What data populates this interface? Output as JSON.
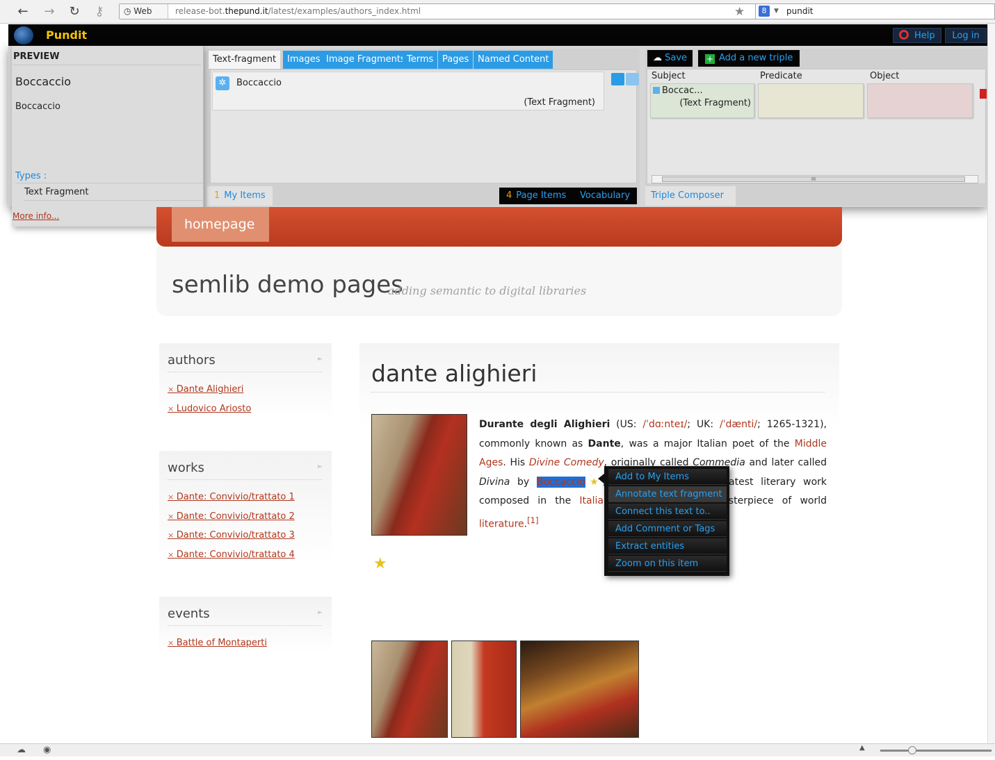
{
  "browser": {
    "back_icon": "←",
    "forward_icon": "→",
    "reload_icon": "↻",
    "key_icon": "⚷",
    "web_label": "Web",
    "url_prefix": "release-bot.",
    "url_domain": "thepund.it",
    "url_path": "/latest/examples/authors_index.html",
    "star_icon": "★",
    "search_engine_letter": "8",
    "search_text": "pundit"
  },
  "pundit": {
    "title": "Pundit",
    "help_label": "Help",
    "login_label": "Log in",
    "preview": {
      "heading": "PREVIEW",
      "title": "Boccaccio",
      "subtitle": "Boccaccio",
      "types_label": "Types :",
      "type_value": "Text Fragment",
      "more_info": "More info..."
    },
    "tabs": [
      "Text-fragment",
      "Images",
      "Image Fragments",
      "Terms",
      "Pages",
      "Named Content"
    ],
    "item": {
      "title": "Boccaccio",
      "type": "(Text Fragment)"
    },
    "footer": {
      "my_items_count": "1",
      "my_items_label": "My Items",
      "page_items_count": "4",
      "page_items_label": "Page Items",
      "vocabulary_label": "Vocabulary"
    },
    "triple": {
      "save_label": "Save",
      "add_triple_label": "Add a new triple",
      "subject_header": "Subject",
      "predicate_header": "Predicate",
      "object_header": "Object",
      "subject_title": "Boccac...",
      "subject_type": "(Text Fragment)",
      "scroll_grip": "III",
      "composer_label": "Triple Composer"
    }
  },
  "site": {
    "home_tab": "homepage",
    "title": "semlib demo pages",
    "subtitle": "adding semantic to digital libraries",
    "authors": {
      "heading": "authors",
      "links": [
        "Dante Alighieri",
        "Ludovico Ariosto"
      ]
    },
    "works": {
      "heading": "works",
      "links": [
        "Dante: Convivio/trattato 1",
        "Dante: Convivio/trattato 2",
        "Dante: Convivio/trattato 3",
        "Dante: Convivio/trattato 4"
      ]
    },
    "events": {
      "heading": "events",
      "links": [
        "Battle of Montaperti"
      ]
    },
    "main": {
      "title": "dante alighieri",
      "full_name": "Durante degli Alighieri",
      "us_label": "(US:",
      "us_ipa": "/ˈdɑːnteɪ/",
      "uk_label": "UK:",
      "uk_ipa": "/ˈdænti/",
      "dates": "1265-1321),",
      "sentence1": "commonly known as",
      "dante": "Dante",
      "sentence2": ", was a major Italian poet of the",
      "middle_ages": "Middle Ages",
      "his": ". His",
      "divine_comedy": "Divine Comedy",
      "orig": ", originally called",
      "commedia": "Commedia",
      "later": "and later called",
      "divina": "Divina",
      "by": "by",
      "boccaccio": "Boccaccio",
      "rest1": ", is considered the greatest literary work composed in the",
      "italian": "Italian",
      "rest2": "language and a masterpiece of world",
      "literature": "literature",
      "footnote": "[1]"
    }
  },
  "context_menu": [
    "Add to My Items",
    "Annotate text fragment",
    "Connect this text to..",
    "Add Comment or Tags",
    "Extract entities",
    "Zoom on this item"
  ],
  "colors": {
    "pundit_blue": "#2aa0f0",
    "pundit_yellow": "#f5c400",
    "link_red": "#b0361c",
    "home_bar": "#c44428"
  }
}
